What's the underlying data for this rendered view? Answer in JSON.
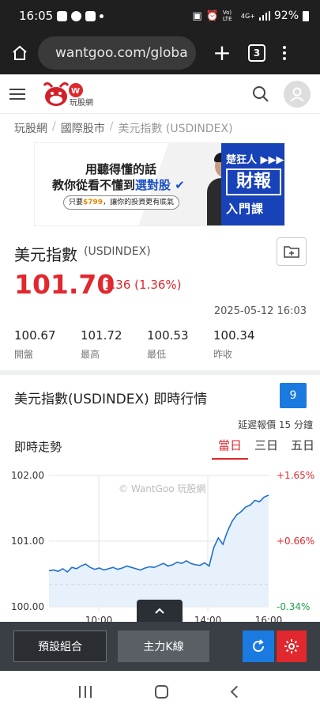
{
  "status_bar": {
    "time": "16:05",
    "battery": "92%",
    "net_label": "4G+",
    "volte_label": "Vo) LTE"
  },
  "browser": {
    "url": "wantgoo.com/globa",
    "tab_count": "3"
  },
  "site": {
    "logo_text": "玩股網"
  },
  "breadcrumb": [
    "玩股網",
    "國際股市",
    "美元指數 (USDINDEX)"
  ],
  "banner": {
    "line1": "用聽得懂的話",
    "line2_prefix": "教你從看不懂到",
    "line2_highlight": "選對股",
    "line3_prefix": "只要",
    "line3_price": "$799",
    "line3_suffix": "，讓你的投資更有底氣",
    "right_name": "楚狂人 ▶▶▶",
    "right_big": "財報",
    "right_sub": "入門課"
  },
  "quote": {
    "name": "美元指數",
    "code": "(USDINDEX)",
    "price": "101.70",
    "change": "1.36 (1.36%)",
    "time": "2025-05-12 16:03",
    "stats": [
      {
        "value": "100.67",
        "label": "開盤"
      },
      {
        "value": "101.72",
        "label": "最高"
      },
      {
        "value": "100.53",
        "label": "最低"
      },
      {
        "value": "100.34",
        "label": "昨收"
      }
    ]
  },
  "realtime": {
    "title": "美元指數(USDINDEX) 即時行情",
    "badge": "9",
    "delay": "延遲報價 15 分鐘",
    "trend_label": "即時走勢",
    "ranges": [
      "當日",
      "三日",
      "五日"
    ],
    "active_range": "當日"
  },
  "chart_data": {
    "type": "line",
    "watermark": "© WantGoo 玩股網",
    "x_ticks": [
      "10:00",
      "14:00",
      "16:00"
    ],
    "y_ticks_left": [
      "102.00",
      "101.00",
      "100.00"
    ],
    "y_ticks_right": [
      "+1.65%",
      "+0.66%",
      "-0.34%"
    ],
    "ylim": [
      100.0,
      102.0
    ],
    "prev_close": 100.34,
    "series": [
      {
        "values": [
          100.55,
          100.56,
          100.54,
          100.58,
          100.53,
          100.6,
          100.58,
          100.62,
          100.65,
          100.6,
          100.57,
          100.59,
          100.56,
          100.58,
          100.6,
          100.57,
          100.59,
          100.62,
          100.6,
          100.58,
          100.56,
          100.59,
          100.61,
          100.6,
          100.63,
          100.66,
          100.62,
          100.64,
          100.68,
          100.66,
          100.7,
          100.66,
          100.64,
          100.63,
          100.67,
          100.62,
          100.9,
          101.05,
          100.95,
          101.15,
          101.3,
          101.4,
          101.45,
          101.52,
          101.55,
          101.62,
          101.6,
          101.67,
          101.7
        ]
      }
    ]
  },
  "actions": {
    "preset": "預設組合",
    "kline": "主力K線"
  },
  "colors": {
    "up": "#e0282e",
    "down": "#1aa34a",
    "accent": "#1a7ae0",
    "line": "#1f6fd1"
  }
}
